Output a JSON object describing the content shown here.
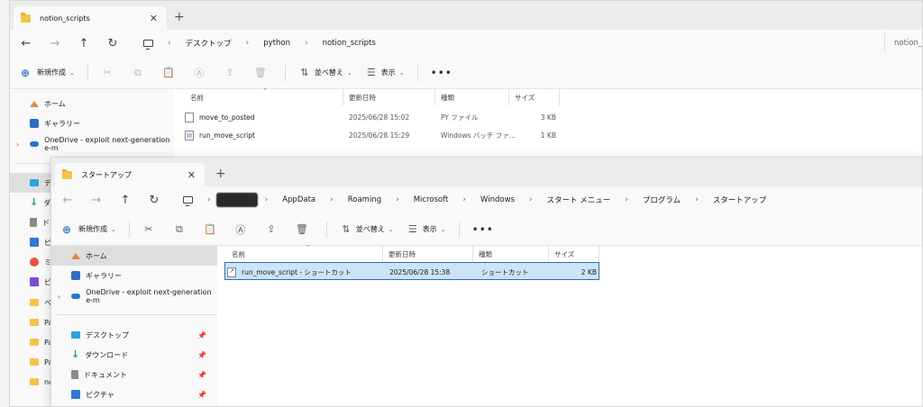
{
  "back_window": {
    "tab_title": "notion_scripts",
    "breadcrumb": [
      "デスクトップ",
      "python",
      "notion_scripts"
    ],
    "search_placeholder": "notion_",
    "toolbar": {
      "new_label": "新規作成",
      "sort_label": "並べ替え",
      "view_label": "表示"
    },
    "sidebar": {
      "home": "ホーム",
      "gallery": "ギャラリー",
      "onedrive": "OneDrive - exploit next-generation e-m",
      "partial_items": [
        {
          "letter": "デ",
          "icon": "desktop-icon"
        },
        {
          "letter": "ダ",
          "icon": "download-icon"
        },
        {
          "letter": "ド",
          "icon": "document-icon"
        },
        {
          "letter": "ピ",
          "icon": "picture-icon"
        },
        {
          "letter": "ミ",
          "icon": "music-icon"
        },
        {
          "letter": "ビ",
          "icon": "video-icon"
        },
        {
          "letter": "ペ",
          "icon": "folder-icon"
        },
        {
          "letter": "Pa",
          "icon": "folder-icon"
        },
        {
          "letter": "Pa",
          "icon": "folder-icon"
        },
        {
          "letter": "Pa",
          "icon": "folder-icon"
        },
        {
          "letter": "no",
          "icon": "folder-icon"
        }
      ]
    },
    "columns": {
      "name": "名前",
      "modified": "更新日時",
      "type": "種類",
      "size": "サイズ"
    },
    "files": [
      {
        "name": "move_to_posted",
        "modified": "2025/06/28 15:02",
        "type": "PY ファイル",
        "size": "3 KB",
        "icon": "python-file-icon"
      },
      {
        "name": "run_move_script",
        "modified": "2025/06/28 15:29",
        "type": "Windows バッチ ファ...",
        "size": "1 KB",
        "icon": "batch-file-icon"
      }
    ]
  },
  "front_window": {
    "tab_title": "スタートアップ",
    "breadcrumb": [
      "AppData",
      "Roaming",
      "Microsoft",
      "Windows",
      "スタート メニュー",
      "プログラム",
      "スタートアップ"
    ],
    "toolbar": {
      "new_label": "新規作成",
      "sort_label": "並べ替え",
      "view_label": "表示"
    },
    "sidebar": {
      "home": "ホーム",
      "gallery": "ギャラリー",
      "onedrive": "OneDrive - exploit next-generation e-m",
      "desktop": "デスクトップ",
      "downloads": "ダウンロード",
      "documents": "ドキュメント",
      "pictures": "ピクチャ"
    },
    "columns": {
      "name": "名前",
      "modified": "更新日時",
      "type": "種類",
      "size": "サイズ"
    },
    "files": [
      {
        "name": "run_move_script - ショートカット",
        "modified": "2025/06/28 15:38",
        "type": "ショートカット",
        "size": "2 KB",
        "icon": "shortcut-icon",
        "selected": true
      }
    ]
  },
  "colors": {
    "selection_bg": "#cce4f7",
    "selection_border": "#2e6db8",
    "folder": "#f4c34a",
    "redaction": "#2a2a2a"
  }
}
